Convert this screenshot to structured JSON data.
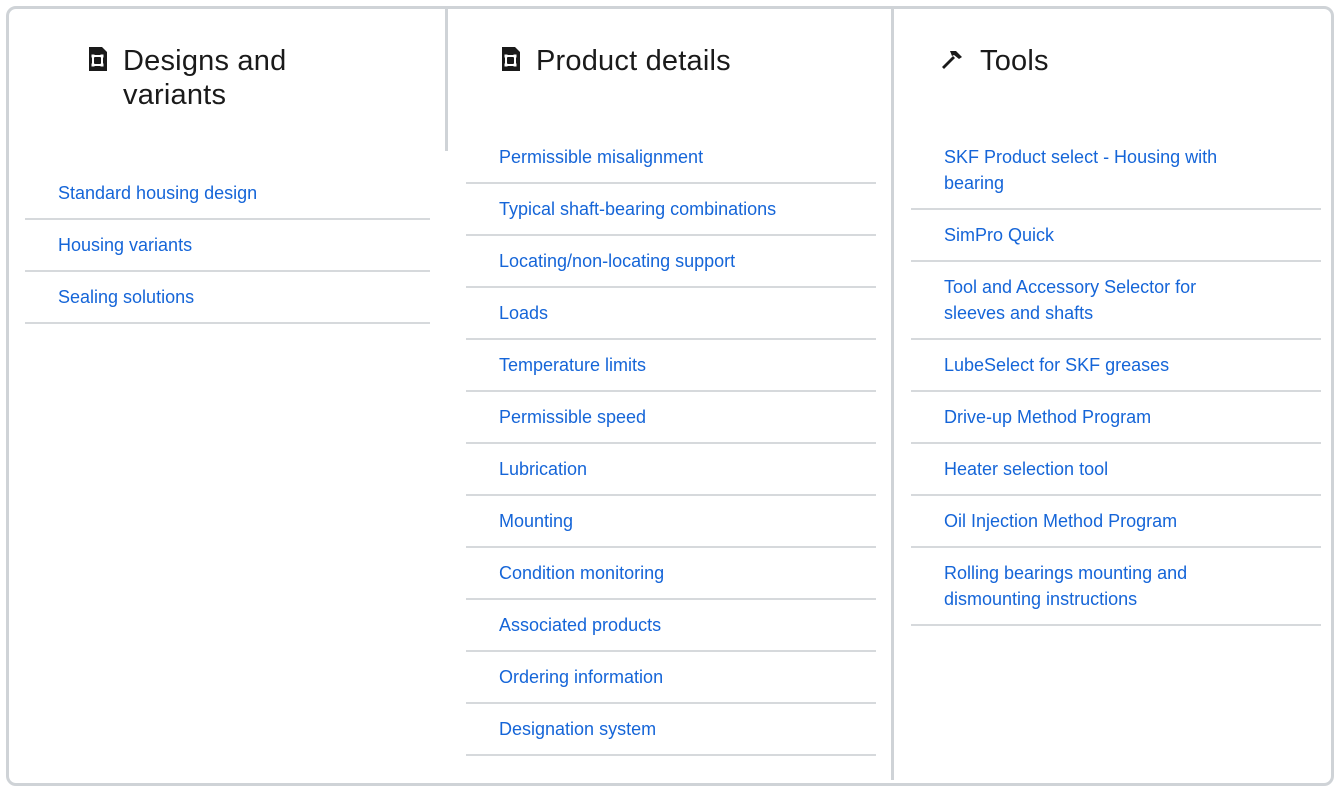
{
  "sections": {
    "designs": {
      "icon": "document-icon",
      "title_line1": "Designs and",
      "title_line2": "variants",
      "items": [
        "Standard housing design",
        "Housing variants",
        "Sealing solutions"
      ]
    },
    "details": {
      "icon": "document-icon",
      "title": "Product details",
      "items": [
        "Permissible misalignment",
        "Typical shaft-bearing combinations",
        "Locating/non-locating support",
        "Loads",
        "Temperature limits",
        "Permissible speed",
        "Lubrication",
        "Mounting",
        "Condition monitoring",
        "Associated products",
        "Ordering information",
        "Designation system"
      ]
    },
    "tools": {
      "icon": "hammer-icon",
      "title": "Tools",
      "items": [
        {
          "line1": "SKF Product select - Housing with",
          "line2": "bearing"
        },
        {
          "line1": "SimPro Quick",
          "line2": ""
        },
        {
          "line1": "Tool and Accessory Selector for",
          "line2": "sleeves and shafts"
        },
        {
          "line1": "LubeSelect for SKF greases",
          "line2": ""
        },
        {
          "line1": "Drive-up Method Program",
          "line2": ""
        },
        {
          "line1": "Heater selection tool",
          "line2": ""
        },
        {
          "line1": "Oil Injection Method Program",
          "line2": ""
        },
        {
          "line1": "Rolling bearings mounting and",
          "line2": "dismounting instructions"
        }
      ]
    }
  },
  "colors": {
    "link": "#1565d8",
    "divider": "#d6d9dc",
    "frame": "#cfd3d7"
  }
}
